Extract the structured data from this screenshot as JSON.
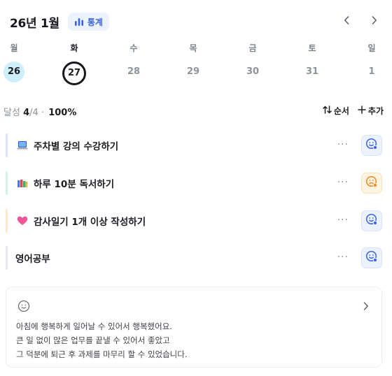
{
  "header": {
    "month": "26년 1월",
    "stats_label": "통계",
    "stats_icon": "bar-chart-icon",
    "prev_icon": "chevron-left-icon",
    "next_icon": "chevron-right-icon"
  },
  "week": {
    "days": [
      "월",
      "화",
      "수",
      "목",
      "금",
      "토",
      "일"
    ],
    "dates": [
      "26",
      "27",
      "28",
      "29",
      "30",
      "31",
      "1"
    ],
    "today_index": 1,
    "done_index": 0
  },
  "summary": {
    "label": "달성",
    "done": "4",
    "total": "/4",
    "sep": "·",
    "percent": "100%"
  },
  "actions": {
    "order_label": "순서",
    "add_label": "추가"
  },
  "tasks": [
    {
      "title": "주차별 강의 수강하기",
      "emoji": "laptop-icon",
      "accent": "#dbe2fb",
      "mood": "smile-icon",
      "mood_color": "#3a63e6",
      "mood_bg": "#edf2ff",
      "more": "···"
    },
    {
      "title": "하루 10분 독서하기",
      "emoji": "books-icon",
      "accent": "#d2f3e4",
      "mood": "frown-icon",
      "mood_color": "#ec8a1e",
      "mood_bg": "#fff3e2",
      "more": "···"
    },
    {
      "title": "감사일기 1개 이상 작성하기",
      "emoji": "heart-icon",
      "accent": "#ffe7c9",
      "mood": "smile-icon",
      "mood_color": "#3a63e6",
      "mood_bg": "#edf2ff",
      "more": "···"
    },
    {
      "title": "영어공부",
      "emoji": "",
      "accent": "#e5e7ec",
      "mood": "smile-icon",
      "mood_color": "#3a63e6",
      "mood_bg": "#edf2ff",
      "more": "···"
    }
  ],
  "journal": {
    "lines": [
      "아침에 행복하게 일어날 수 있어서 행복했어요.",
      "큰 일 없이 많은 업무를 끝낼 수 있어서 좋았고",
      "그 덕분에 퇴근 후 과제를 마무리 할 수 있었습니다."
    ]
  }
}
